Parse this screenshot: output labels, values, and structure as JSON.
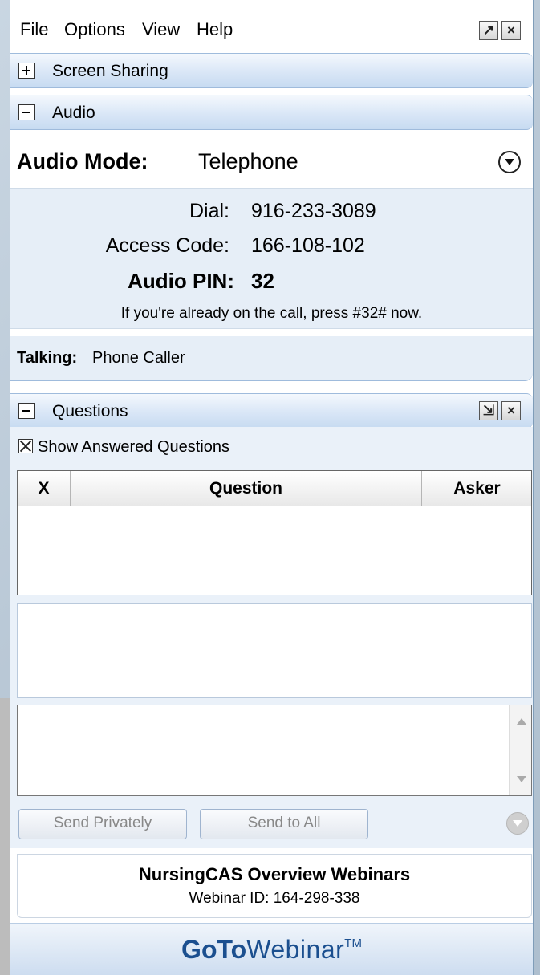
{
  "menubar": {
    "items": [
      "File",
      "Options",
      "View",
      "Help"
    ],
    "popout_icon": "popout-icon",
    "close_icon": "close-icon"
  },
  "sections": {
    "screen_sharing": {
      "title": "Screen Sharing",
      "state": "collapsed"
    },
    "audio": {
      "title": "Audio",
      "state": "expanded"
    },
    "questions": {
      "title": "Questions",
      "state": "expanded"
    }
  },
  "audio": {
    "mode_label": "Audio Mode:",
    "mode_value": "Telephone",
    "dial_label": "Dial:",
    "dial_value": "916-233-3089",
    "access_label": "Access Code:",
    "access_value": "166-108-102",
    "pin_label": "Audio PIN:",
    "pin_value": "32",
    "note": "If you're already on the call, press #32# now.",
    "talking_label": "Talking:",
    "talking_value": "Phone Caller"
  },
  "questions": {
    "show_answered_label": "Show Answered Questions",
    "show_answered_checked": true,
    "columns": [
      "X",
      "Question",
      "Asker"
    ],
    "rows": [],
    "send_privately_label": "Send Privately",
    "send_all_label": "Send to All"
  },
  "footer": {
    "webinar_title": "NursingCAS Overview Webinars",
    "webinar_id": "Webinar ID: 164-298-338",
    "brand_bold": "GoTo",
    "brand_light": "Webinar",
    "brand_tm": "TM"
  },
  "colors": {
    "header_blue": "#c7dbf1",
    "info_band": "#e6eef7",
    "brand": "#1b4f8f"
  }
}
